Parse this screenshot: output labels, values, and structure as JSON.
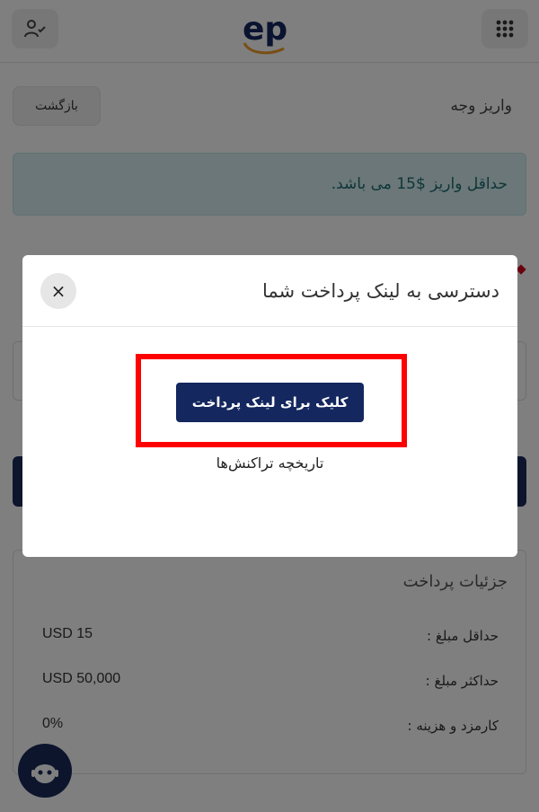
{
  "header": {
    "logo_text": "ep",
    "user_icon": "user-check-icon",
    "apps_icon": "grid-dots-icon"
  },
  "page": {
    "title": "واریز وجه",
    "back_label": "بازگشت",
    "info_alert": "حداقل واریز $15 می باشد."
  },
  "details": {
    "title": "جزئیات پرداخت",
    "rows": [
      {
        "label": "حداقل مبلغ :",
        "value": "USD 15"
      },
      {
        "label": "حداکثر مبلغ :",
        "value": "USD 50,000"
      },
      {
        "label": "کارمزد و هزینه :",
        "value": "0%"
      }
    ]
  },
  "modal": {
    "title": "دسترسی به لینک پرداخت شما",
    "close_label": "×",
    "pay_button_label": "کلیک برای لینک پرداخت",
    "history_link": "تاریخچه تراکنش‌ها"
  },
  "colors": {
    "brand_navy": "#14275e",
    "brand_orange": "#f39a2b",
    "highlight_red": "#ff0000",
    "alert_bg": "#d7eef0"
  }
}
